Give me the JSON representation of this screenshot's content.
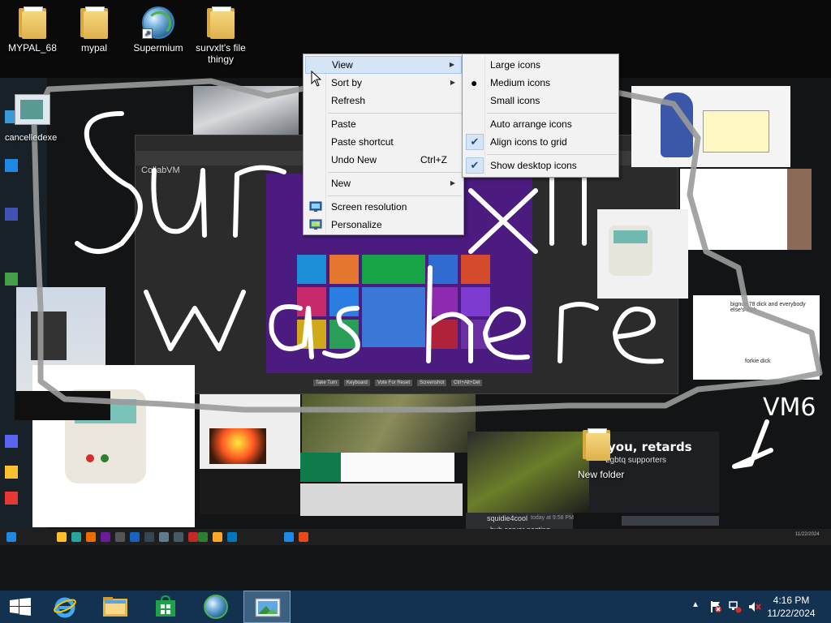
{
  "desktop": {
    "icons": [
      {
        "label": "MYPAL_68",
        "kind": "folder"
      },
      {
        "label": "mypal",
        "kind": "folder"
      },
      {
        "label": "Supermium",
        "kind": "browser"
      },
      {
        "label": "survxlt's file thingy",
        "kind": "folder"
      }
    ],
    "cancelled_label": "cancelledexe",
    "new_folder_label": "New folder"
  },
  "wallpaper": {
    "scribble_line1": "Sur  xlt",
    "scribble_line2": "was here",
    "scribble_tag": "VM6",
    "banner_text": "y you, retards",
    "banner_sub": "Lgbtq supporters",
    "chat_user": "squidie4cool",
    "chat_time": "today at 9:58 PM",
    "chat_msg": "hub server posting",
    "sketch_text": "bignuts78 dick and everybody else's dick",
    "sketch_small": "forkie dick",
    "collab_title": "CollabVM",
    "inner_clock": "11/22/2024",
    "toolbar_items": [
      "Take Turn",
      "Keyboard",
      "Vote For Reset",
      "Screenshot",
      "Ctrl+Alt+Del"
    ]
  },
  "context_menu": {
    "items": [
      {
        "label": "View",
        "submenu": true,
        "hover": true
      },
      {
        "label": "Sort by",
        "submenu": true
      },
      {
        "label": "Refresh"
      },
      {
        "label": "Paste"
      },
      {
        "label": "Paste shortcut"
      },
      {
        "label": "Undo New",
        "shortcut": "Ctrl+Z"
      },
      {
        "label": "New",
        "submenu": true
      },
      {
        "label": "Screen resolution",
        "icon": "monitor-icon"
      },
      {
        "label": "Personalize",
        "icon": "personalize-icon"
      }
    ]
  },
  "view_submenu": {
    "items": [
      {
        "label": "Large icons"
      },
      {
        "label": "Medium icons",
        "selected": true
      },
      {
        "label": "Small icons"
      },
      {
        "label": "Auto arrange icons"
      },
      {
        "label": "Align icons to grid",
        "checked": true
      },
      {
        "label": "Show desktop icons",
        "checked": true
      }
    ]
  },
  "taskbar": {
    "pinned": [
      "start-button",
      "internet-explorer-icon",
      "file-explorer-icon",
      "store-icon",
      "supermium-icon",
      "photo-viewer-icon"
    ],
    "time": "4:16 PM",
    "date": "11/22/2024"
  },
  "colors": {
    "taskbar": "#13324f",
    "menu_bg": "#f2f2f2",
    "menu_hover": "#d5e4f6",
    "start_purple": "#4b1b7f"
  }
}
